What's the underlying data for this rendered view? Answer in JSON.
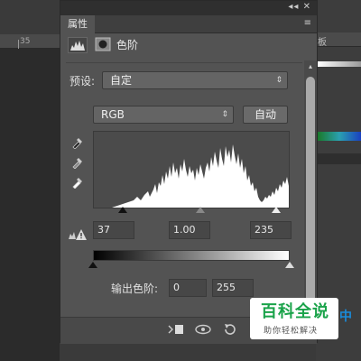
{
  "background": {
    "ruler_number": "35",
    "right_panel_tab": "板"
  },
  "panel": {
    "window_controls": "◂◂ ✕",
    "tab_label": "属性",
    "tab_menu": "≡",
    "title": "色阶",
    "preset_label": "预设:",
    "preset_value": "自定",
    "channel_value": "RGB",
    "auto_button": "自动",
    "input_black": "37",
    "input_gamma": "1.00",
    "input_white": "235",
    "output_label": "输出色阶:",
    "output_black": "0",
    "output_white": "255"
  },
  "colors": {
    "panel_bg": "#535353",
    "histogram": "#ffffff",
    "watermark_green": "#1aa34a",
    "watermark_blue": "#1a8ad8"
  },
  "icons": {
    "levels": "levels-icon",
    "mask": "mask-icon",
    "eyedroppers": [
      "black-eyedropper-icon",
      "gray-eyedropper-icon",
      "white-eyedropper-icon"
    ],
    "bottom": [
      "clip-to-layer-icon",
      "visibility-icon",
      "reset-icon"
    ]
  },
  "watermark": {
    "title": "百科全说",
    "subtitle": "助你轻松解决",
    "side": "中"
  }
}
